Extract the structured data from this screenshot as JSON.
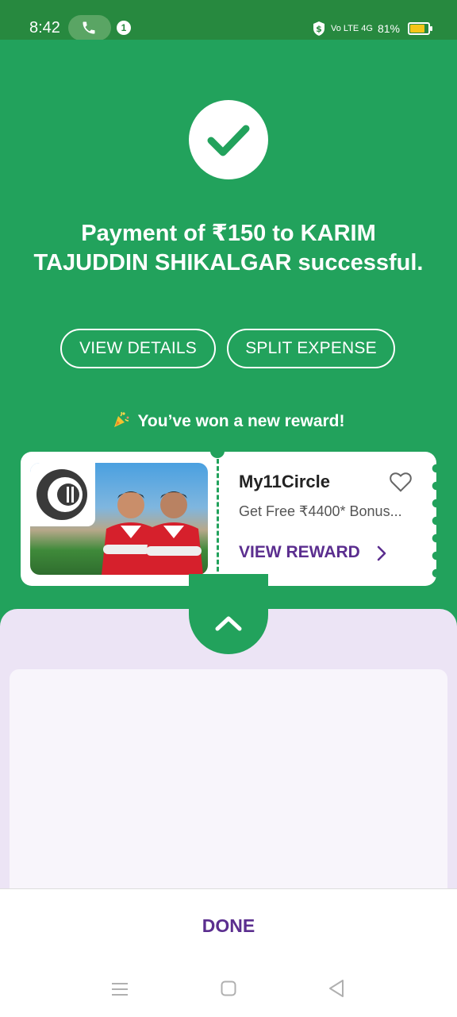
{
  "status_bar": {
    "time": "8:42",
    "notification_count": "1",
    "network": "Vo LTE 4G",
    "battery": "81%",
    "battery_level": 0.81
  },
  "payment": {
    "message": "Payment of ₹150 to KARIM TAJUDDIN SHIKALGAR successful.",
    "view_details_label": "VIEW DETAILS",
    "split_expense_label": "SPLIT EXPENSE"
  },
  "reward": {
    "banner": "You’ve won a new reward!",
    "brand": "My11Circle",
    "description": "Get Free ₹4400* Bonus...",
    "cta": "VIEW REWARD"
  },
  "footer": {
    "done_label": "DONE"
  },
  "icons": [
    "phone-icon",
    "shield-dollar-icon",
    "battery-icon",
    "checkmark-icon",
    "party-popper-icon",
    "heart-icon",
    "chevron-right-icon",
    "chevron-up-icon",
    "menu-icon",
    "home-icon",
    "back-icon"
  ],
  "colors": {
    "status_bar": "#27893f",
    "success_green": "#22a25c",
    "accent_purple": "#5b2e8f",
    "panel_lavender": "#ece4f5"
  }
}
